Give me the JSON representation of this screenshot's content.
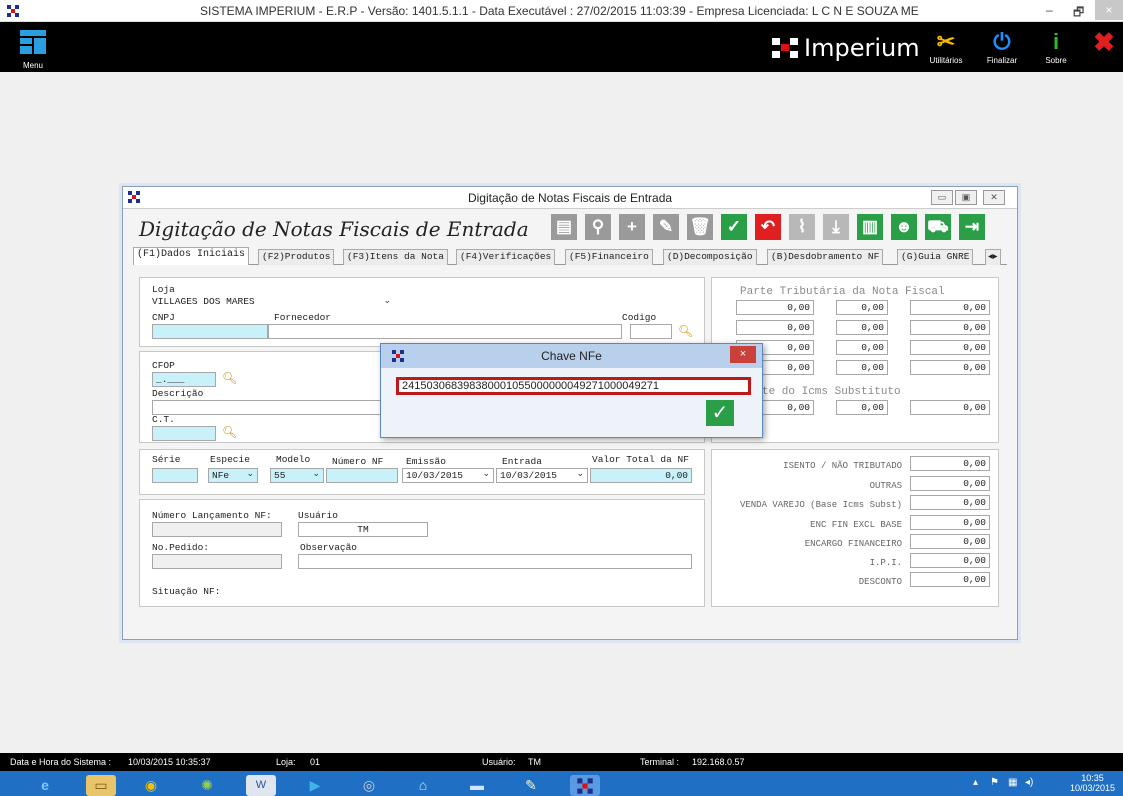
{
  "titlebar": {
    "title": "SISTEMA IMPERIUM - E.R.P - Versão: 1401.5.1.1 - Data Executável : 27/02/2015 11:03:39 - Empresa Licenciada: L C N E SOUZA ME",
    "minimize": "–",
    "restore": "🗗",
    "close": "×"
  },
  "topbar": {
    "menu_label": "Menu",
    "brand": "Imperium",
    "buttons": [
      {
        "label": "Utilitários",
        "icon": "tools-icon",
        "color": "#f5b800"
      },
      {
        "label": "Finalizar",
        "icon": "power-icon",
        "color": "#1e90ff"
      },
      {
        "label": "Sobre",
        "icon": "info-icon",
        "color": "#2eb82e"
      },
      {
        "label": "",
        "icon": "close-x-icon",
        "color": "#e02020"
      }
    ]
  },
  "form_window": {
    "title": "Digitação de Notas Fiscais de Entrada",
    "heading": "Digitação de Notas Fiscais de Entrada",
    "tabs": [
      "(F1)Dados Iniciais",
      "(F2)Produtos",
      "(F3)Itens da Nota",
      "(F4)Verificações",
      "(F5)Financeiro",
      "(D)Decomposição",
      "(B)Desdobramento NF",
      "(G)Guia GNRE"
    ],
    "loja": {
      "label": "Loja",
      "value": "VILLAGES DOS MARES",
      "cnpj_label": "CNPJ",
      "fornecedor_label": "Fornecedor",
      "codigo_label": "Codigo"
    },
    "cfop": {
      "label": "CFOP",
      "value": "_.___",
      "descricao_label": "Descrição",
      "ct_label": "C.T."
    },
    "nota": {
      "serie_label": "Série",
      "especie_label": "Especie",
      "especie_value": "NFe",
      "modelo_label": "Modelo",
      "modelo_value": "55",
      "numero_label": "Número NF",
      "emissao_label": "Emissão",
      "emissao_value": "10/03/2015",
      "entrada_label": "Entrada",
      "entrada_value": "10/03/2015",
      "valor_total_label": "Valor Total da NF",
      "valor_total_value": "0,00"
    },
    "lancamento": {
      "numero_label": "Número Lançamento NF:",
      "usuario_label": "Usuário",
      "usuario_value": "TM",
      "pedido_label": "No.Pedido:",
      "observacao_label": "Observação",
      "situacao_label": "Situação NF:"
    },
    "tributaria": {
      "heading": "Parte Tributária da Nota Fiscal",
      "rows": [
        [
          "0,00",
          "0,00",
          "0,00"
        ],
        [
          "0,00",
          "0,00",
          "0,00"
        ],
        [
          "0,00",
          "0,00",
          "0,00"
        ],
        [
          "0,00",
          "0,00",
          "0,00"
        ]
      ],
      "substituto_heading": "te do Icms Substituto",
      "substituto_row": [
        "0,00",
        "0,00",
        "0,00"
      ]
    },
    "totais": [
      {
        "label": "ISENTO / NÃO TRIBUTADO",
        "value": "0,00"
      },
      {
        "label": "OUTRAS",
        "value": "0,00"
      },
      {
        "label": "VENDA VAREJO (Base Icms Subst)",
        "value": "0,00"
      },
      {
        "label": "ENC FIN EXCL BASE",
        "value": "0,00"
      },
      {
        "label": "ENCARGO FINANCEIRO",
        "value": "0,00"
      },
      {
        "label": "I.P.I.",
        "value": "0,00"
      },
      {
        "label": "DESCONTO",
        "value": "0,00"
      }
    ]
  },
  "dialog": {
    "title": "Chave NFe",
    "value": "24150306839838000105500000004927100004927​1",
    "close": "×",
    "confirm": "✓"
  },
  "statusbar": {
    "datetime_label": "Data e Hora do Sistema :",
    "datetime_value": "10/03/2015 10:35:37",
    "loja_label": "Loja:",
    "loja_value": "01",
    "usuario_label": "Usuário:",
    "usuario_value": "TM",
    "terminal_label": "Terminal :",
    "terminal_value": "192.168.0.57"
  },
  "taskbar": {
    "time": "10:35",
    "date": "10/03/2015"
  },
  "colors": {
    "accent_green": "#2b9e48",
    "accent_red": "#c01818",
    "field_cyan": "#c9f1f9",
    "taskbar_blue": "#1f6fc4"
  }
}
